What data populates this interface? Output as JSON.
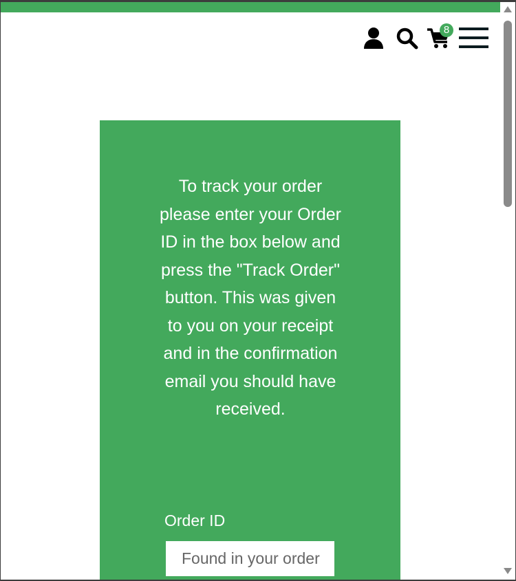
{
  "header": {
    "cart_count": "8",
    "icons": [
      "user-icon",
      "search-icon",
      "cart-icon",
      "menu-icon"
    ]
  },
  "track_order": {
    "instructions": "To track your order please enter your Order ID in the box below and press the \"Track Order\" button. This was given to you on your receipt and in the confirmation email you should have received.",
    "order_id_label": "Order ID",
    "order_id_placeholder": "Found in your order",
    "order_id_value": ""
  },
  "colors": {
    "brand_green": "#43a95c",
    "dark_icon": "#0b1b1f",
    "frame": "#3c3c3c",
    "scrollbar": "#8a8a8a"
  }
}
